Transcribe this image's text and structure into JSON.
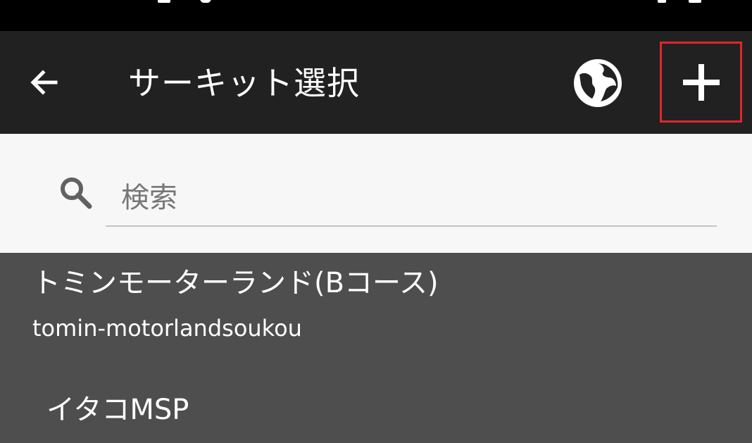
{
  "app_bar": {
    "title": "サーキット選択",
    "back_icon": "arrow-back-icon",
    "globe_icon": "globe-icon",
    "add_icon": "plus-icon"
  },
  "search": {
    "placeholder": "検索",
    "value": ""
  },
  "colors": {
    "app_bar_bg": "#212121",
    "highlight_box": "#e0262b",
    "list_bg": "#4e4e4e"
  },
  "circuits": [
    {
      "name": "トミンモーターランド(Bコース)",
      "id": "tomin-motorlandsoukou"
    },
    {
      "name": "イタコMSP",
      "id": ""
    }
  ]
}
